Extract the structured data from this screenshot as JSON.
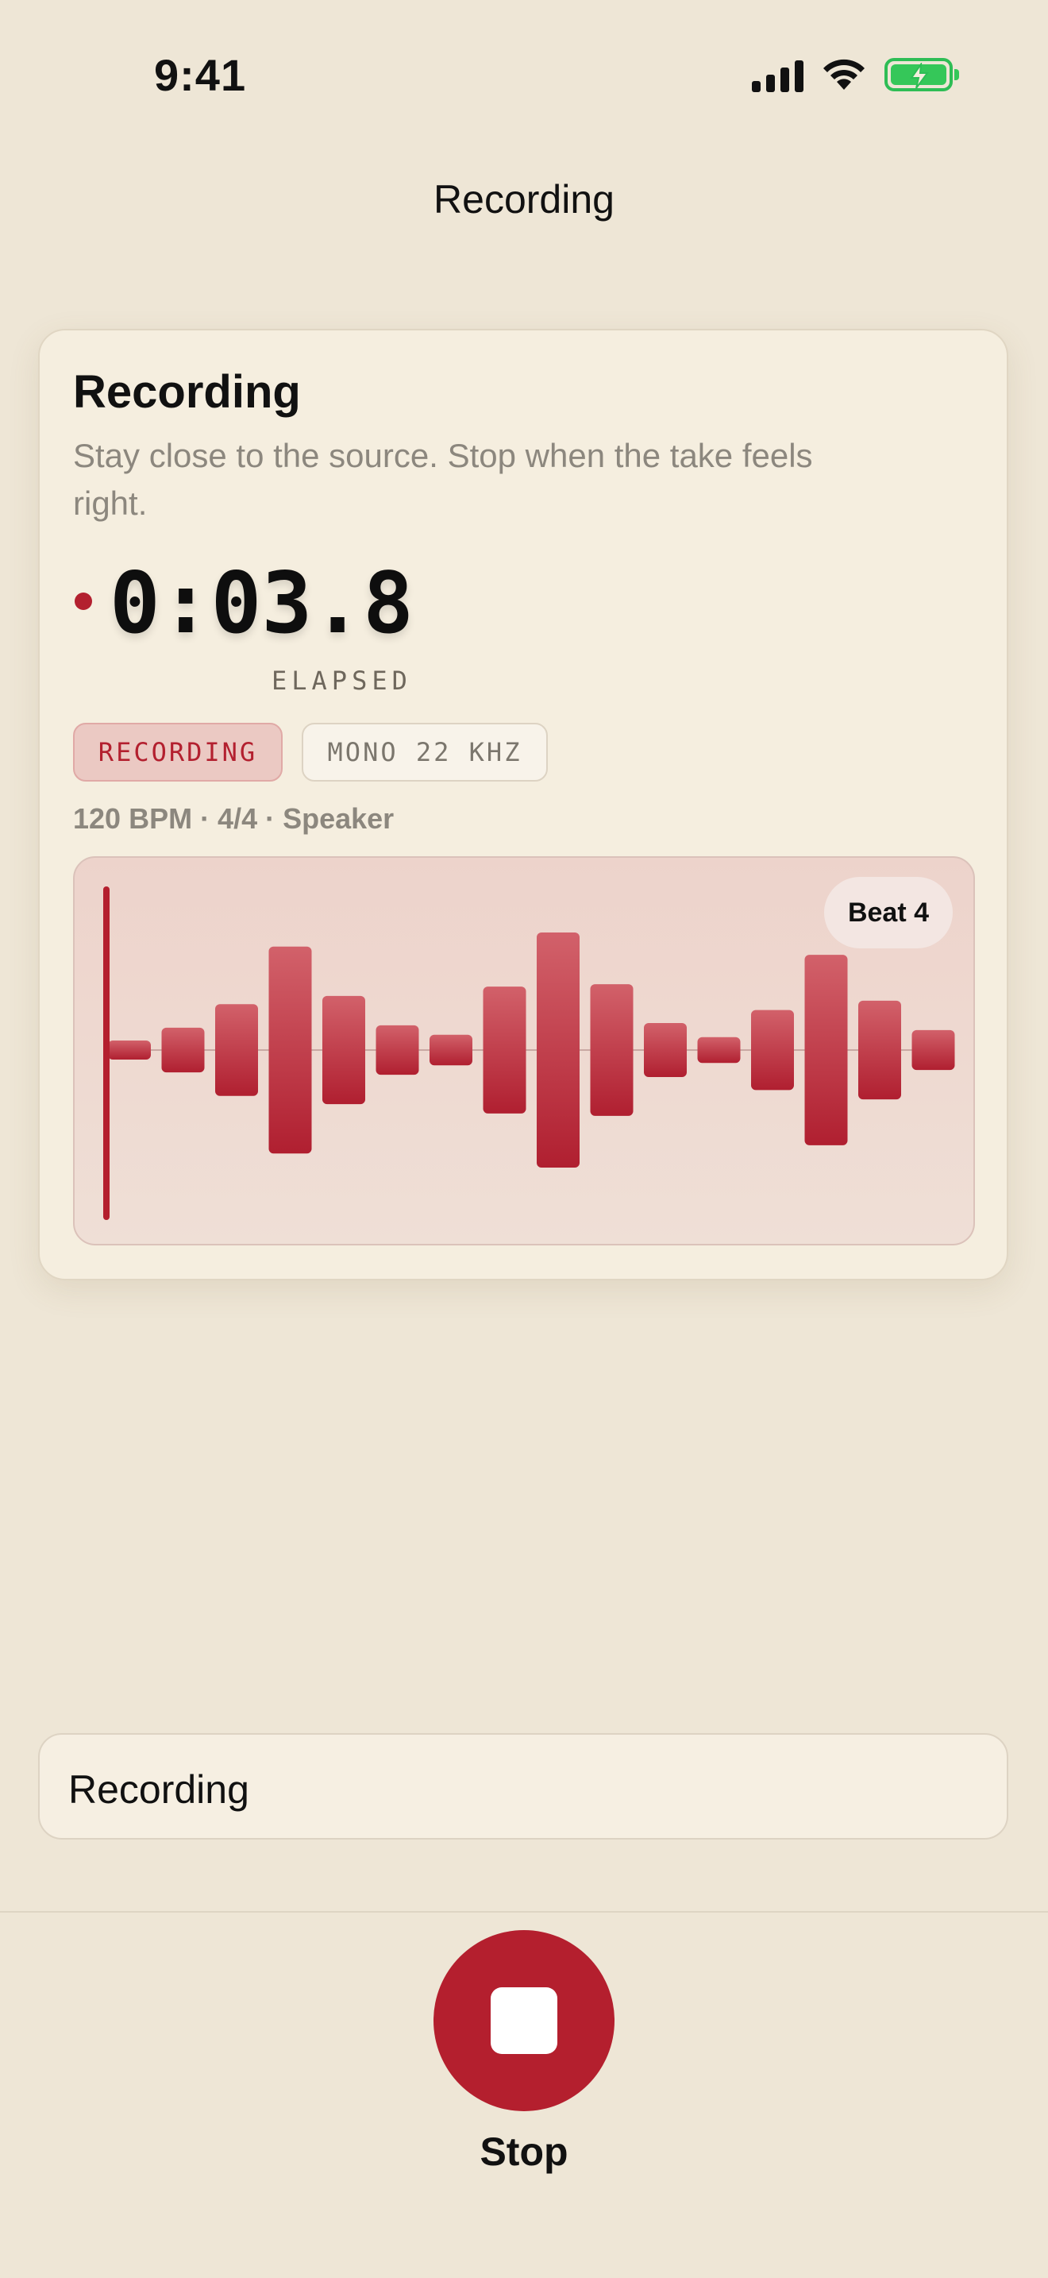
{
  "status_bar": {
    "time": "9:41"
  },
  "nav": {
    "title": "Recording"
  },
  "card": {
    "title": "Recording",
    "subtitle": "Stay close to the source. Stop when the take feels right.",
    "elapsed": "0:03.8",
    "elapsed_label": "ELAPSED",
    "chips": {
      "state": "RECORDING",
      "format": "MONO 22 KHZ"
    },
    "meta": "120 BPM · 4/4 · Speaker",
    "beat_badge": "Beat 4",
    "waveform_levels": [
      0.08,
      0.19,
      0.39,
      0.88,
      0.46,
      0.21,
      0.13,
      0.54,
      1.0,
      0.56,
      0.23,
      0.11,
      0.34,
      0.81,
      0.42,
      0.17
    ]
  },
  "status_field": {
    "label": "Recording"
  },
  "controls": {
    "stop_label": "Stop"
  },
  "colors": {
    "accent": "#B41F2E",
    "background": "#EEE6D6",
    "card": "#F5EEDF"
  }
}
